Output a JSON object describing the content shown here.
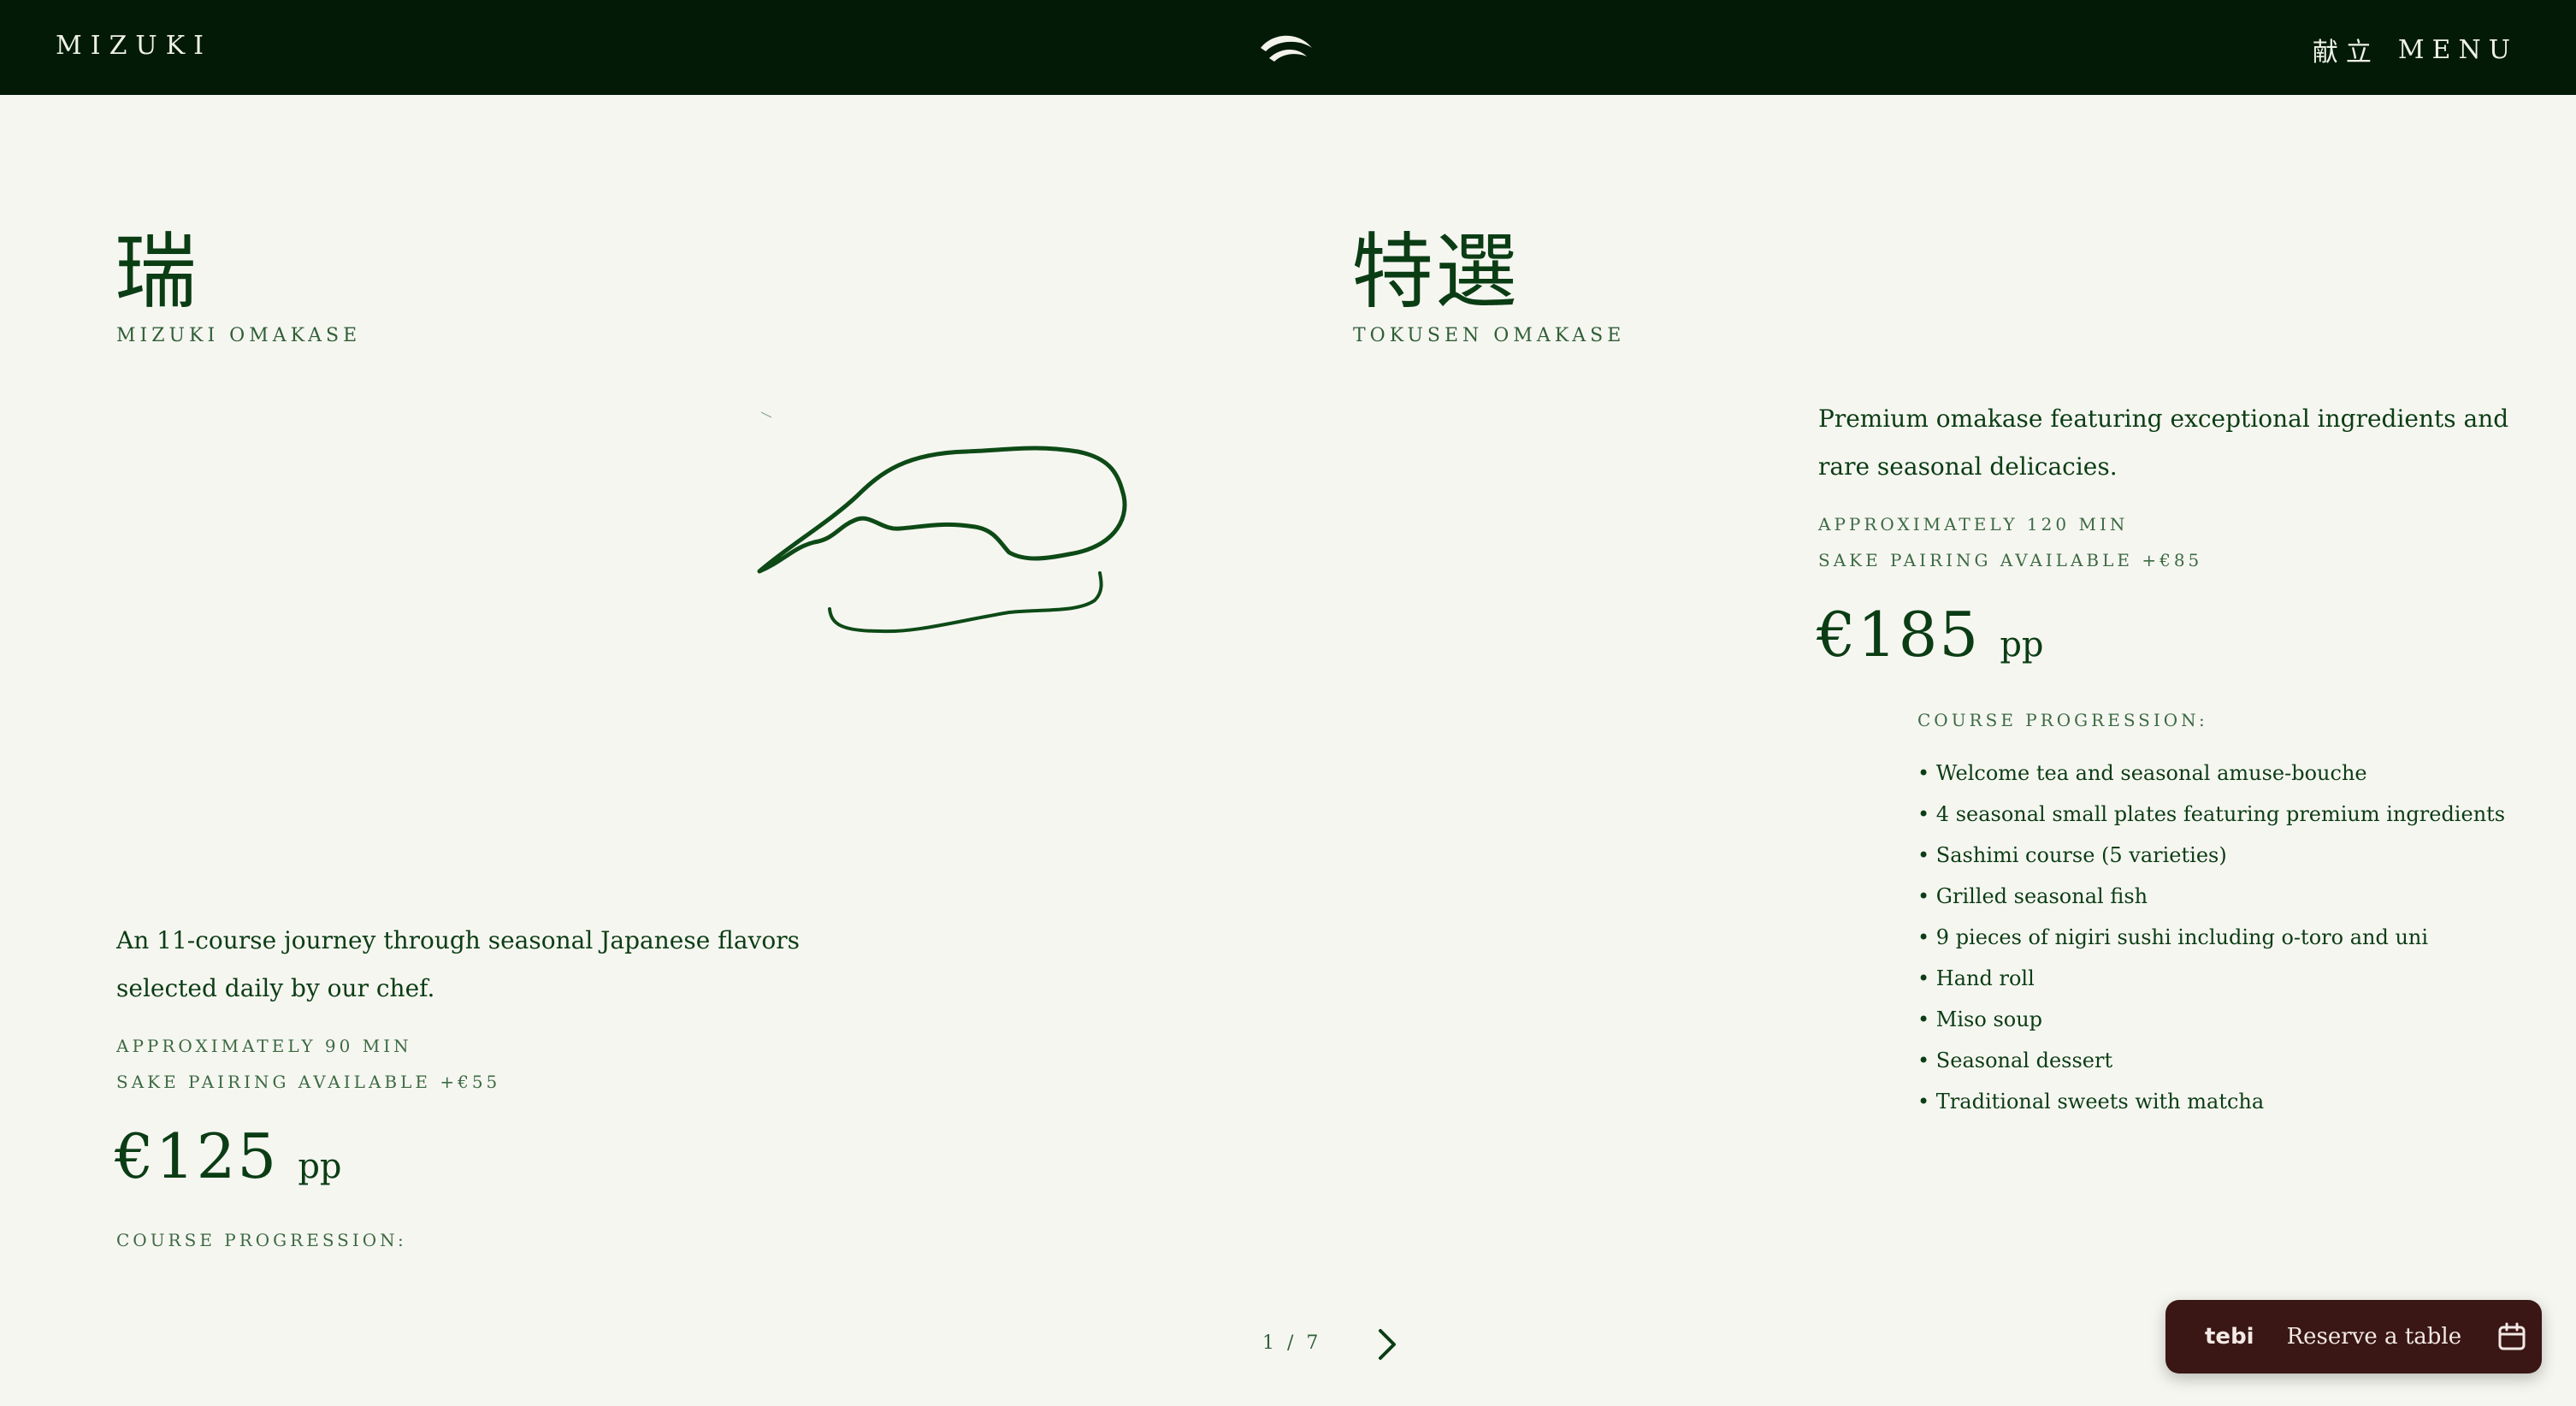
{
  "header": {
    "brand": "MIZUKI",
    "logo_icon": "wave-logo-icon",
    "menu_kanji": "献立",
    "menu_label": "MENU"
  },
  "left_course": {
    "kanji": "瑞",
    "subtitle": "MIZUKI OMAKASE",
    "description_line1": "An 11-course journey through seasonal Japanese flavors",
    "description_line2": "selected daily by our chef.",
    "duration": "APPROXIMATELY 90 MIN",
    "sake": "SAKE PAIRING AVAILABLE +€55",
    "price": "€125",
    "price_unit": "pp",
    "course_title": "COURSE PROGRESSION:",
    "illustration_icon": "sushi-sketch-icon"
  },
  "right_course": {
    "kanji": "特選",
    "subtitle": "TOKUSEN OMAKASE",
    "description_line1": "Premium omakase featuring exceptional ingredients and",
    "description_line2": "rare seasonal delicacies.",
    "duration": "APPROXIMATELY 120 MIN",
    "sake": "SAKE PAIRING AVAILABLE +€85",
    "price": "€185",
    "price_unit": "pp",
    "course_title": "COURSE PROGRESSION:",
    "courses": [
      "Welcome tea and seasonal amuse-bouche",
      "4 seasonal small plates featuring premium ingredients",
      "Sashimi course (5 varieties)",
      "Grilled seasonal fish",
      "9 pieces of nigiri sushi including o-toro and uni",
      "Hand roll",
      "Miso soup",
      "Seasonal dessert",
      "Traditional sweets with matcha"
    ]
  },
  "pagination": {
    "label": "1 / 7",
    "next_icon": "chevron-right-icon"
  },
  "reserve": {
    "brand": "tebi",
    "label": "Reserve a table",
    "icon": "calendar-icon"
  },
  "colors": {
    "header_bg": "#031a07",
    "text_green": "#0b3d14",
    "page_bg": "#f6f6f1",
    "reserve_bg": "#3a1714"
  }
}
